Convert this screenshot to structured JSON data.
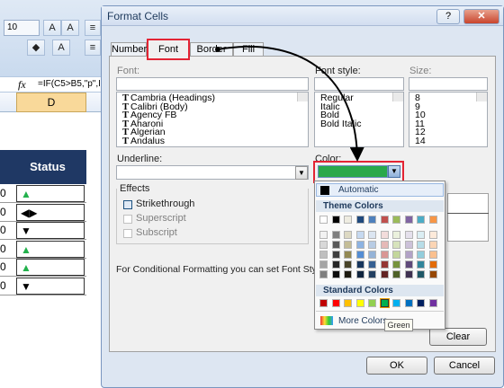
{
  "spreadsheet": {
    "font_size": "10",
    "formula": "=IF(C5>B5,\"p\",I",
    "fx_label": "fx",
    "column_header": "D",
    "status_header": "Status",
    "rows": [
      {
        "num": "0",
        "symbol": "▲",
        "kind": "up"
      },
      {
        "num": "0",
        "symbol": "◀▶",
        "kind": "both"
      },
      {
        "num": "0",
        "symbol": "▼",
        "kind": "down"
      },
      {
        "num": "0",
        "symbol": "▲",
        "kind": "up"
      },
      {
        "num": "0",
        "symbol": "▲",
        "kind": "up"
      },
      {
        "num": "0",
        "symbol": "▼",
        "kind": "down"
      }
    ]
  },
  "dialog": {
    "title": "Format Cells",
    "help": "?",
    "close": "✕",
    "tabs": [
      "Number",
      "Font",
      "Border",
      "Fill"
    ],
    "active_tab": "Font",
    "font_label": "Font:",
    "font_style_label": "Font style:",
    "size_label": "Size:",
    "fonts": [
      "Cambria (Headings)",
      "Calibri (Body)",
      "Agency FB",
      "Aharoni",
      "Algerian",
      "Andalus"
    ],
    "styles": [
      "Regular",
      "Italic",
      "Bold",
      "Bold Italic"
    ],
    "sizes": [
      "8",
      "9",
      "10",
      "11",
      "12",
      "14"
    ],
    "underline_label": "Underline:",
    "color_label": "Color:",
    "effects_label": "Effects",
    "effects": [
      {
        "label": "Strikethrough",
        "checked": true,
        "enabled": true
      },
      {
        "label": "Superscript",
        "checked": false,
        "enabled": false
      },
      {
        "label": "Subscript",
        "checked": false,
        "enabled": false
      }
    ],
    "info_text": "For Conditional Formatting you can set Font Style, Unde",
    "clear_button": "Clear",
    "ok_button": "OK",
    "cancel_button": "Cancel",
    "selected_color": "#2aa84a"
  },
  "palette": {
    "automatic_label": "Automatic",
    "theme_header": "Theme Colors",
    "standard_header": "Standard Colors",
    "more_colors_label": "More Colors...",
    "tooltip": "Green",
    "theme_top": [
      "#ffffff",
      "#000000",
      "#eeece1",
      "#1f497d",
      "#4f81bd",
      "#c0504d",
      "#9bbb59",
      "#8064a2",
      "#4bacc6",
      "#f79646"
    ],
    "theme_shades": [
      [
        "#f2f2f2",
        "#7f7f7f",
        "#ddd9c3",
        "#c6d9f0",
        "#dbe5f1",
        "#f2dcdb",
        "#ebf1dd",
        "#e5e0ec",
        "#dbeef3",
        "#fdeada"
      ],
      [
        "#d8d8d8",
        "#595959",
        "#c4bd97",
        "#8db3e2",
        "#b8cce4",
        "#e5b9b7",
        "#d7e3bc",
        "#ccc1d9",
        "#b7dde8",
        "#fbd5b5"
      ],
      [
        "#bfbfbf",
        "#3f3f3f",
        "#938953",
        "#548dd4",
        "#95b3d7",
        "#d99694",
        "#c3d69b",
        "#b2a2c7",
        "#92cddc",
        "#fac08f"
      ],
      [
        "#a5a5a5",
        "#262626",
        "#494429",
        "#17365d",
        "#366092",
        "#953734",
        "#76923c",
        "#5f497a",
        "#31859b",
        "#e36c09"
      ],
      [
        "#7f7f7f",
        "#0c0c0c",
        "#1d1b10",
        "#0f243e",
        "#244061",
        "#632423",
        "#4f6128",
        "#3f3151",
        "#205867",
        "#974806"
      ]
    ],
    "standard": [
      "#c00000",
      "#ff0000",
      "#ffc000",
      "#ffff00",
      "#92d050",
      "#00b050",
      "#00b0f0",
      "#0070c0",
      "#002060",
      "#7030a0"
    ],
    "selected_standard_index": 5
  }
}
